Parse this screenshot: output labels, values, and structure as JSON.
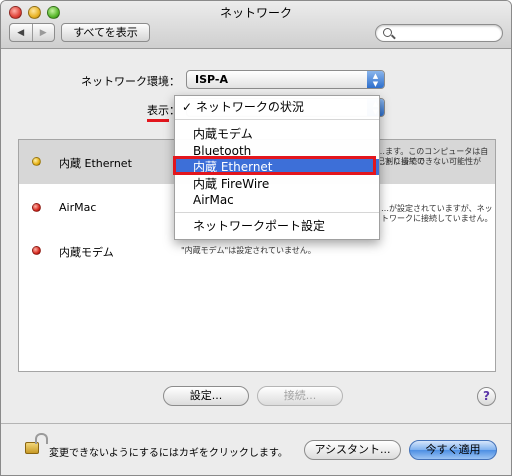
{
  "window": {
    "title": "ネットワーク"
  },
  "toolbar": {
    "back": "◀",
    "forward": "▶",
    "show_all": "すべてを表示",
    "search_value": ""
  },
  "location": {
    "label": "ネットワーク環境：",
    "value": "ISP-A"
  },
  "show": {
    "label": "表示："
  },
  "menu": {
    "checked": "✓ ネットワークの状況",
    "items": [
      "内蔵モデム",
      "Bluetooth",
      "内蔵 Ethernet",
      "内蔵 FireWire",
      "AirMac"
    ],
    "port_settings": "ネットワークポート設定"
  },
  "interfaces": [
    {
      "name": "内蔵 Ethernet",
      "status_color": "#e6b012",
      "status": [
        "…ます。このコンピュータは自己割り当ての",
        "…トに接続できない可能性が"
      ]
    },
    {
      "name": "AirMac",
      "status_color": "#d6271e",
      "status": [
        "…が設定されていますが、ネットワークに接続していません。"
      ]
    },
    {
      "name": "内蔵モデム",
      "status_color": "#d6271e",
      "status": [
        "\"内蔵モデム\"は設定されていません。"
      ]
    }
  ],
  "buttons": {
    "configure": "設定...",
    "connect": "接続...",
    "help": "?",
    "assistant": "アシスタント...",
    "apply": "今すぐ適用"
  },
  "lock": {
    "text": "変更できないようにするにはカギをクリックします。"
  },
  "colors": {
    "highlight": "#3d6fd8",
    "annotation_red": "#e3161d"
  }
}
